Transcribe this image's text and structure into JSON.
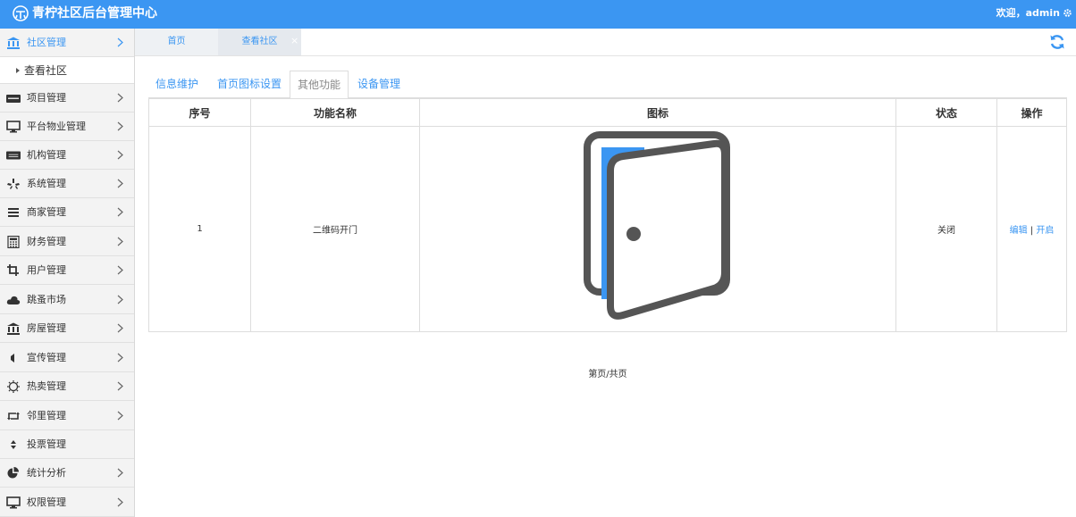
{
  "header": {
    "app_title": "青柠社区后台管理中心",
    "welcome": "欢迎，admin",
    "brand_color": "#3b96f2"
  },
  "sidebar": {
    "items": [
      {
        "label": "社区管理",
        "icon": "bank-icon"
      },
      {
        "label": "项目管理",
        "icon": "discover-card-icon"
      },
      {
        "label": "平台物业管理",
        "icon": "desktop-icon"
      },
      {
        "label": "机构管理",
        "icon": "stripe-icon"
      },
      {
        "label": "系统管理",
        "icon": "yelp-icon"
      },
      {
        "label": "商家管理",
        "icon": "bars-icon"
      },
      {
        "label": "财务管理",
        "icon": "calculator-icon"
      },
      {
        "label": "用户管理",
        "icon": "crop-icon"
      },
      {
        "label": "跳蚤市场",
        "icon": "cloud-icon"
      },
      {
        "label": "房屋管理",
        "icon": "bank-icon"
      },
      {
        "label": "宣传管理",
        "icon": "volume-icon"
      },
      {
        "label": "热卖管理",
        "icon": "sun-icon"
      },
      {
        "label": "邻里管理",
        "icon": "retweet-icon"
      },
      {
        "label": "投票管理",
        "icon": "sort-icon"
      },
      {
        "label": "统计分析",
        "icon": "pie-chart-icon"
      },
      {
        "label": "权限管理",
        "icon": "desktop-icon"
      }
    ],
    "sub_item": "查看社区"
  },
  "tabs": {
    "home": "首页",
    "view": "查看社区",
    "close": "×"
  },
  "subtabs": [
    "信息维护",
    "首页图标设置",
    "其他功能",
    "设备管理"
  ],
  "table": {
    "headers": [
      "序号",
      "功能名称",
      "图标",
      "状态",
      "操作"
    ],
    "rows": [
      {
        "index": "1",
        "name": "二维码开门",
        "icon": "door-icon",
        "status": "关闭",
        "edit": "编辑",
        "sep": " | ",
        "open": "开启"
      }
    ]
  },
  "pager": "第页/共页"
}
